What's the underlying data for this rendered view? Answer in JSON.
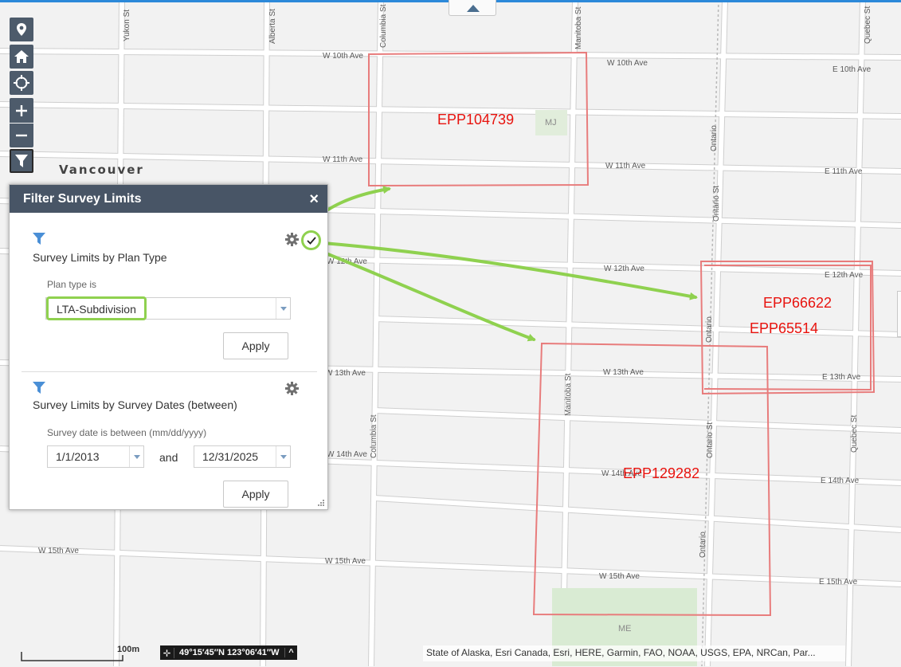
{
  "map": {
    "city_label": "Vancouver",
    "streets": {
      "yukon": "Yukon St",
      "alberta": "Alberta St",
      "columbia": "Columbia St",
      "manitoba": "Manitoba St",
      "ontario": "Ontario St",
      "ontario_rail": "Ontario",
      "quebec": "Quebec St",
      "w10": "W 10th Ave",
      "e10": "E 10th Ave",
      "w11": "W 11th Ave",
      "w11b": "W 11th Ave",
      "e11": "E 11th Ave",
      "w12": "W 12th Ave",
      "e12": "E 12th Ave",
      "w13": "W 13th Ave",
      "e13": "E 13th Ave",
      "w14": "W 14th Ave",
      "e14": "E 14th Ave",
      "w15": "W 15th Ave",
      "e15": "E 15th Ave"
    },
    "zones": {
      "mj": "MJ",
      "me": "ME"
    },
    "survey_plans": [
      "EPP104739",
      "EPP66622",
      "EPP65514",
      "EPP129282"
    ],
    "colors": {
      "plan_outline": "#e87c7c",
      "plan_label": "#e8130e",
      "annotation_arrow": "#8fd14f",
      "road": "#ffffff",
      "road_edge": "#cfcfcf"
    }
  },
  "toolbar": {
    "items": [
      "location-pin-icon",
      "home-icon",
      "locate-icon",
      "zoom-in-icon",
      "zoom-out-icon",
      "filter-icon"
    ]
  },
  "filter_panel": {
    "title": "Filter Survey Limits",
    "close": "×",
    "sections": [
      {
        "title": "Survey Limits by Plan Type",
        "field_label": "Plan type is",
        "value": "LTA-Subdivision",
        "apply": "Apply",
        "checked": true
      },
      {
        "title": "Survey Limits by Survey Dates (between)",
        "field_label": "Survey date is between (mm/dd/yyyy)",
        "start": "1/1/2013",
        "joiner": "and",
        "end": "12/31/2025",
        "apply": "Apply",
        "checked": false
      }
    ]
  },
  "status": {
    "scale": "100m",
    "coordinates": "49°15′45″N 123°06′41″W",
    "attribution": "State of Alaska, Esri Canada, Esri, HERE, Garmin, FAO, NOAA, USGS, EPA, NRCan, Par..."
  }
}
